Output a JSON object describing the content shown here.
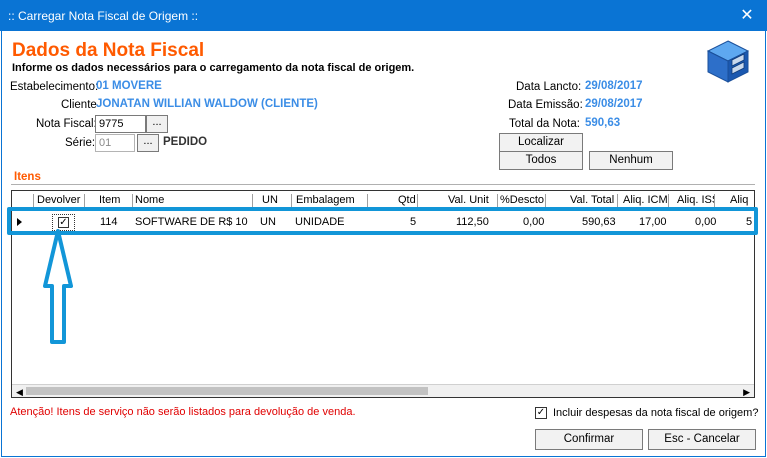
{
  "window": {
    "title": ":: Carregar Nota Fiscal de Origem ::",
    "close_glyph": "✕"
  },
  "header": {
    "title": "Dados da Nota Fiscal",
    "subtitle": "Informe os dados necessários para o carregamento da nota fiscal de origem."
  },
  "form": {
    "estabelecimento_label": "Estabelecimento:",
    "estabelecimento_value": "01  MOVERE",
    "cliente_label": "Cliente",
    "cliente_value": "JONATAN WILLIAN WALDOW (CLIENTE)",
    "nota_fiscal_label": "Nota Fiscal:",
    "nota_fiscal_value": "9775",
    "serie_label": "Série:",
    "serie_value": "01",
    "serie_description": "PEDIDO",
    "lookup_label": "...",
    "data_lancto_label": "Data Lancto:",
    "data_lancto_value": "29/08/2017",
    "data_emissao_label": "Data Emissão:",
    "data_emissao_value": "29/08/2017",
    "total_nota_label": "Total da Nota:",
    "total_nota_value": "590,63"
  },
  "buttons": {
    "localizar": "Localizar",
    "todos": "Todos",
    "nenhum": "Nenhum",
    "confirmar": "Confirmar",
    "cancelar": "Esc - Cancelar"
  },
  "itens": {
    "section_label": "Itens",
    "columns": [
      "Devolver",
      "Item",
      "Nome",
      "UN",
      "Embalagem",
      "Qtd",
      "Val. Unit",
      "%Descto",
      "Val. Total",
      "Aliq. ICM",
      "Aliq. ISS",
      "Aliq"
    ],
    "rows": [
      {
        "devolver": "✓",
        "item": "114",
        "nome": "SOFTWARE DE R$ 10",
        "un": "UN",
        "embalagem": "UNIDADE",
        "qtd": "5",
        "val_unit": "112,50",
        "descto": "0,00",
        "val_total": "590,63",
        "aliq_icm": "17,00",
        "aliq_iss": "0,00",
        "aliq": "5"
      }
    ]
  },
  "footer": {
    "warning": "Atenção! Itens de serviço não serão listados para devolução de venda.",
    "incluir_despesas_label": "Incluir despesas da nota fiscal de origem?",
    "incluir_despesas_checked": "✓"
  },
  "colors": {
    "titlebar": "#0a74d4",
    "heading": "#ff5a00",
    "value_blue": "#3b8de6",
    "highlight": "#1296d8",
    "warning": "#e00000"
  },
  "icons": {
    "app_icon": "blue-cube-cabinet-icon",
    "annotation_arrow": "up-arrow-annotation-icon"
  }
}
